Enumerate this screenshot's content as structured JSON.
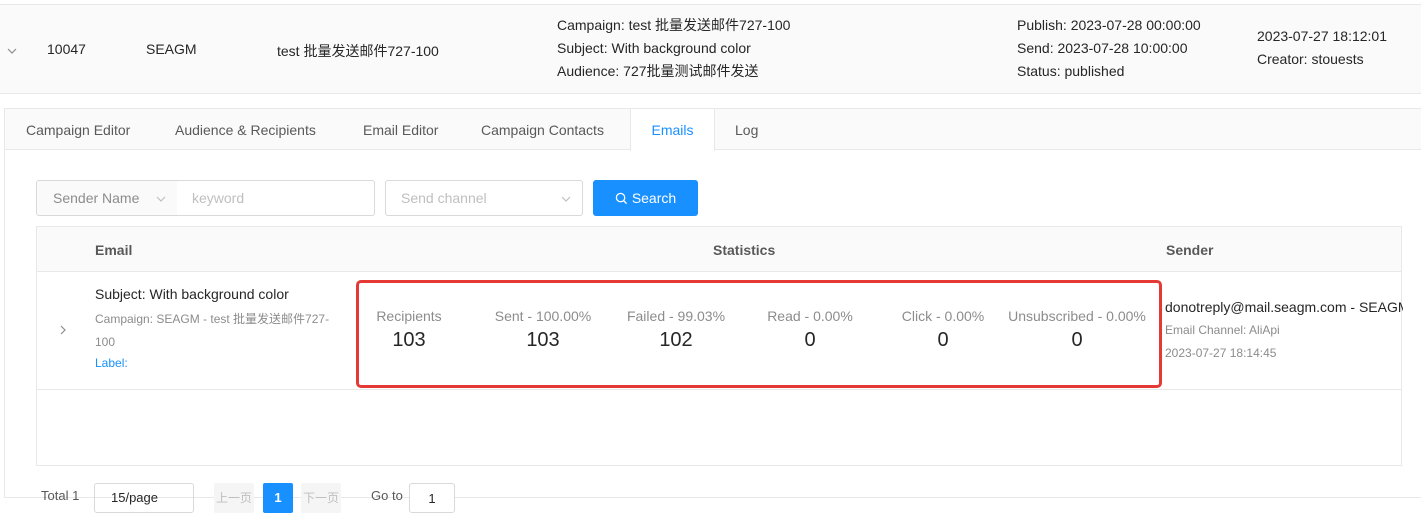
{
  "campaign": {
    "id": "10047",
    "brand": "SEAGM",
    "name": "test 批量发送邮件727-100",
    "campaign_line": "Campaign: test 批量发送邮件727-100",
    "subject_line": "Subject: With background color",
    "audience_line": "Audience: 727批量测试邮件发送",
    "publish_line": "Publish: 2023-07-28 00:00:00",
    "send_line": "Send: 2023-07-28 10:00:00",
    "status_line": "Status: published",
    "created_at": "2023-07-27 18:12:01",
    "creator_line": "Creator: stouests"
  },
  "tabs": [
    {
      "label": "Campaign Editor"
    },
    {
      "label": "Audience & Recipients"
    },
    {
      "label": "Email Editor"
    },
    {
      "label": "Campaign Contacts"
    },
    {
      "label": "Emails",
      "active": true
    },
    {
      "label": "Log"
    }
  ],
  "filters": {
    "sender_select": "Sender Name",
    "keyword_placeholder": "keyword",
    "channel_placeholder": "Send channel",
    "search_label": "Search"
  },
  "table": {
    "headers": {
      "email": "Email",
      "statistics": "Statistics",
      "sender": "Sender"
    },
    "rows": [
      {
        "subject": "Subject: With background color",
        "campaign": "Campaign: SEAGM - test 批量发送邮件727-100",
        "label": "Label:",
        "stats": [
          {
            "label": "Recipients",
            "value": "103"
          },
          {
            "label": "Sent - 100.00%",
            "value": "103"
          },
          {
            "label": "Failed - 99.03%",
            "value": "102"
          },
          {
            "label": "Read - 0.00%",
            "value": "0"
          },
          {
            "label": "Click - 0.00%",
            "value": "0"
          },
          {
            "label": "Unsubscribed - 0.00%",
            "value": "0"
          }
        ],
        "sender_email": "donotreply@mail.seagm.com - SEAGM",
        "sender_channel": "Email Channel: AliApi",
        "sender_time": "2023-07-27 18:14:45"
      }
    ]
  },
  "pagination": {
    "total": "Total 1",
    "page_size": "15/page",
    "prev": "上一页",
    "current": "1",
    "next": "下一页",
    "goto_label": "Go to",
    "goto_value": "1"
  },
  "colors": {
    "accent": "#1890ff",
    "highlight": "#e53935"
  }
}
